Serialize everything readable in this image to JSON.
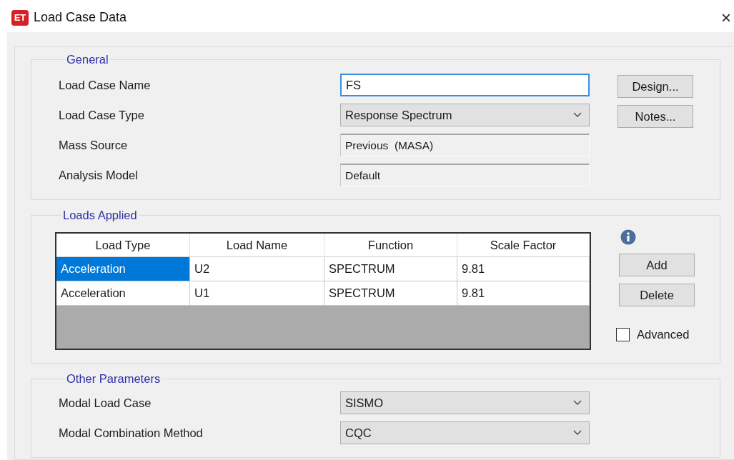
{
  "window": {
    "title": "Load Case Data",
    "close": "×",
    "app_badge": "ET"
  },
  "general": {
    "label": "General",
    "fields": [
      {
        "label": "Load Case Name",
        "kind": "text",
        "value": "FS"
      },
      {
        "label": "Load Case Type",
        "kind": "dropdown",
        "value": "Response Spectrum"
      },
      {
        "label": "Mass Source",
        "kind": "readonly",
        "value": "Previous  (MASA)"
      },
      {
        "label": "Analysis Model",
        "kind": "readonly",
        "value": "Default"
      }
    ],
    "buttons": [
      "Design...",
      "Notes..."
    ]
  },
  "loads_applied": {
    "label": "Loads Applied",
    "table": {
      "columns": [
        "Load Type",
        "Load Name",
        "Function",
        "Scale Factor"
      ],
      "rows": [
        {
          "cells": [
            "Acceleration",
            "U2",
            "SPECTRUM",
            "9.81"
          ],
          "selected": true
        },
        {
          "cells": [
            "Acceleration",
            "U1",
            "SPECTRUM",
            "9.81"
          ],
          "selected": false
        }
      ]
    },
    "buttons": [
      "Add",
      "Delete"
    ],
    "advanced": {
      "label": "Advanced",
      "checked": false
    }
  },
  "other_parameters": {
    "label": "Other Parameters",
    "fields": [
      {
        "label": "Modal Load Case",
        "kind": "dropdown",
        "value": "SISMO"
      },
      {
        "label": "Modal Combination Method",
        "kind": "dropdown",
        "value": "CQC"
      }
    ]
  }
}
